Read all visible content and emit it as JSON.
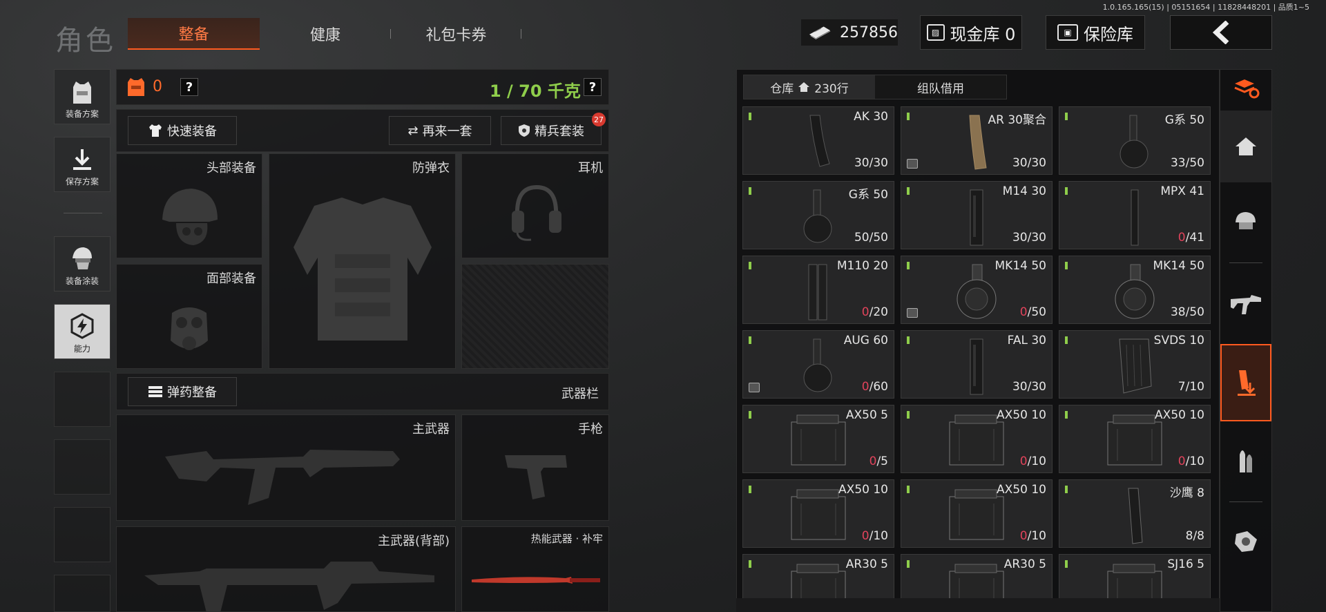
{
  "version": "1.0.165.165(15) | 05151654 | 11828448201 | 品质1~5",
  "header": {
    "title": "角色",
    "tabs": [
      {
        "label": "整备",
        "active": true
      },
      {
        "label": "健康",
        "active": false
      },
      {
        "label": "礼包卡券",
        "active": false
      }
    ],
    "money": "257856",
    "cash_vault": "现金库 0",
    "safe_box": "保险库"
  },
  "left_sidebar": [
    {
      "label": "装备方案",
      "icon": "vest-plan-icon"
    },
    {
      "label": "保存方案",
      "icon": "download-icon"
    },
    {
      "label": "装备涂装",
      "icon": "helmet-skin-icon"
    },
    {
      "label": "能力",
      "icon": "ability-icon",
      "highlighted": true
    }
  ],
  "equipment": {
    "armor_count": "0",
    "weight": "1 / 70 千克",
    "quick_equip": "快速装备",
    "reroll": "再来一套",
    "elite_set": "精兵套装",
    "elite_badge": "27",
    "slots": {
      "head": "头部装备",
      "vest": "防弹衣",
      "headset": "耳机",
      "face": "面部装备"
    },
    "ammo_equip": "弹药整备",
    "weapon_bar": "武器栏",
    "primary": "主武器",
    "pistol": "手枪",
    "primary_back": "主武器(背部)",
    "thermal": "热能武器 · 补牢"
  },
  "inventory": {
    "tab_storage": "仓库",
    "rows": "230行",
    "tab_team": "组队借用",
    "items": [
      {
        "name": "AK 30",
        "cur": "30",
        "max": "30",
        "empty": false,
        "box": false,
        "mag": "curved"
      },
      {
        "name": "AR 30聚合",
        "cur": "30",
        "max": "30",
        "empty": false,
        "box": true,
        "mag": "tan"
      },
      {
        "name": "G系 50",
        "cur": "33",
        "max": "50",
        "empty": false,
        "box": false,
        "mag": "drum"
      },
      {
        "name": "G系 50",
        "cur": "50",
        "max": "50",
        "empty": false,
        "box": false,
        "mag": "drum"
      },
      {
        "name": "M14 30",
        "cur": "30",
        "max": "30",
        "empty": false,
        "box": false,
        "mag": "straight"
      },
      {
        "name": "MPX 41",
        "cur": "0",
        "max": "41",
        "empty": true,
        "box": false,
        "mag": "thin"
      },
      {
        "name": "M110 20",
        "cur": "0",
        "max": "20",
        "empty": true,
        "box": false,
        "mag": "double"
      },
      {
        "name": "MK14 50",
        "cur": "0",
        "max": "50",
        "empty": true,
        "box": true,
        "mag": "bigdrum"
      },
      {
        "name": "MK14 50",
        "cur": "38",
        "max": "50",
        "empty": false,
        "box": false,
        "mag": "bigdrum"
      },
      {
        "name": "AUG 60",
        "cur": "0",
        "max": "60",
        "empty": true,
        "box": true,
        "mag": "drum"
      },
      {
        "name": "FAL 30",
        "cur": "30",
        "max": "30",
        "empty": false,
        "box": false,
        "mag": "straight"
      },
      {
        "name": "SVDS 10",
        "cur": "7",
        "max": "10",
        "empty": false,
        "box": false,
        "mag": "short"
      },
      {
        "name": "AX50 5",
        "cur": "0",
        "max": "5",
        "empty": true,
        "box": false,
        "mag": "block"
      },
      {
        "name": "AX50 10",
        "cur": "0",
        "max": "10",
        "empty": true,
        "box": false,
        "mag": "block"
      },
      {
        "name": "AX50 10",
        "cur": "0",
        "max": "10",
        "empty": true,
        "box": false,
        "mag": "block"
      },
      {
        "name": "AX50 10",
        "cur": "0",
        "max": "10",
        "empty": true,
        "box": false,
        "mag": "block"
      },
      {
        "name": "AX50 10",
        "cur": "0",
        "max": "10",
        "empty": true,
        "box": false,
        "mag": "block"
      },
      {
        "name": "沙鹰 8",
        "cur": "8",
        "max": "8",
        "empty": false,
        "box": false,
        "mag": "pistol"
      },
      {
        "name": "AR30 5",
        "cur": "",
        "max": "",
        "empty": false,
        "box": false,
        "mag": "block"
      },
      {
        "name": "AR30 5",
        "cur": "",
        "max": "",
        "empty": false,
        "box": false,
        "mag": "block"
      },
      {
        "name": "SJ16 5",
        "cur": "",
        "max": "",
        "empty": false,
        "box": false,
        "mag": "block"
      }
    ]
  },
  "right_sidebar": [
    {
      "icon": "stack-refresh-icon",
      "active": false
    },
    {
      "icon": "home-icon",
      "active": false
    },
    {
      "icon": "helmet-icon",
      "active": false
    },
    {
      "icon": "rifle-icon",
      "active": false
    },
    {
      "icon": "magazine-icon",
      "active": true
    },
    {
      "icon": "ammo-icon",
      "active": false
    },
    {
      "icon": "scope-icon",
      "active": false
    }
  ],
  "colors": {
    "accent": "#ff5a1f",
    "green": "#8fce4b",
    "empty_red": "#e0435b"
  }
}
